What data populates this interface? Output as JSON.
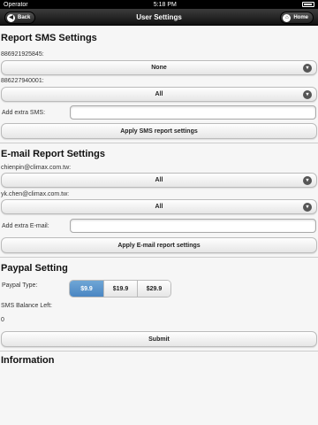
{
  "status_bar": {
    "carrier": "Operator",
    "time": "5:18 PM"
  },
  "header": {
    "title": "User Settings",
    "back_label": "Back",
    "home_label": "Home"
  },
  "sms": {
    "title": "Report SMS Settings",
    "numbers": [
      {
        "label": "886921925845:",
        "value": "None"
      },
      {
        "label": "886227940001:",
        "value": "All"
      }
    ],
    "extra_label": "Add extra SMS:",
    "extra_value": "",
    "apply_label": "Apply SMS report settings"
  },
  "email": {
    "title": "E-mail Report Settings",
    "addresses": [
      {
        "label": "chienpin@climax.com.tw:",
        "value": "All"
      },
      {
        "label": "yk.chen@climax.com.tw:",
        "value": "All"
      }
    ],
    "extra_label": "Add extra E-mail:",
    "extra_value": "",
    "apply_label": "Apply E-mail report settings"
  },
  "paypal": {
    "title": "Paypal Setting",
    "type_label": "Paypal Type:",
    "options": [
      "$9.9",
      "$19.9",
      "$29.9"
    ],
    "selected": "$9.9",
    "balance_label": "SMS Balance Left:",
    "balance_value": "0",
    "submit_label": "Submit"
  },
  "information": {
    "title": "Information"
  },
  "colors": {
    "accent": "#4a86c2",
    "header": "#1a1a1a"
  }
}
